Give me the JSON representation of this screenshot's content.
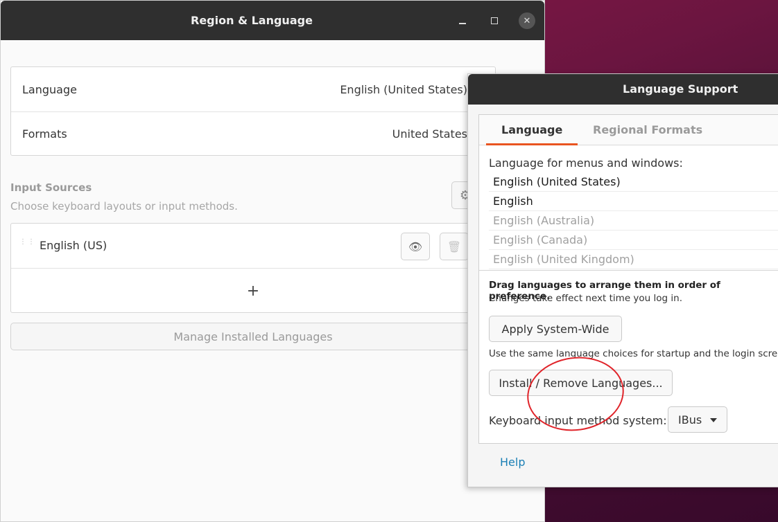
{
  "region_window": {
    "title": "Region & Language",
    "controls": {
      "minimize_icon": "minimize-icon",
      "maximize_icon": "maximize-icon",
      "close_icon": "close-icon"
    },
    "language_row": {
      "label": "Language",
      "value": "English (United States)"
    },
    "formats_row": {
      "label": "Formats",
      "value": "United States"
    },
    "input_sources": {
      "title": "Input Sources",
      "subtitle": "Choose keyboard layouts or input methods.",
      "items": [
        {
          "label": "English (US)"
        }
      ],
      "add_symbol": "+"
    },
    "manage_button": "Manage Installed Languages"
  },
  "language_support": {
    "title": "Language Support",
    "tabs": [
      {
        "label": "Language"
      },
      {
        "label": "Regional Formats"
      }
    ],
    "menus_label": "Language for menus and windows:",
    "languages": [
      {
        "label": "English (United States)",
        "state": "active"
      },
      {
        "label": "English",
        "state": "active"
      },
      {
        "label": "English (Australia)",
        "state": "inactive"
      },
      {
        "label": "English (Canada)",
        "state": "inactive"
      },
      {
        "label": "English (United Kingdom)",
        "state": "inactive"
      }
    ],
    "drag_hint": "Drag languages to arrange them in order of preference.",
    "changes_note": "Changes take effect next time you log in.",
    "apply_button": "Apply System-Wide",
    "use_note": "Use the same language choices for startup and the login screen.",
    "install_button": "Install / Remove Languages...",
    "keyboard_label": "Keyboard input method system:",
    "keyboard_value": "IBus",
    "help_link": "Help"
  },
  "colors": {
    "accent": "#e95420",
    "link": "#1a7fb5",
    "annotation": "#e0242a"
  }
}
